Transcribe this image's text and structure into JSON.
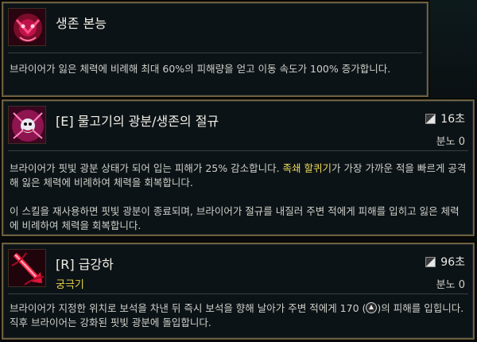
{
  "passive": {
    "title": "생존 본능",
    "description": "브라이어가 잃은 체력에 비례해 최대 60%의 피해량을 얻고 이동 속도가 100% 증가합니다."
  },
  "e_ability": {
    "title": "[E] 물고기의 광분/생존의 절규",
    "cooldown": "16초",
    "cost": "분노 0",
    "desc1_before": "브라이어가 핏빛 광분 상태가 되어 입는 피해가 25% 감소합니다. ",
    "desc1_highlight": "족쇄 할퀴기",
    "desc1_after": "가 가장 가까운 적을 빠르게 공격해 잃은 체력에 비례하여 체력을 회복합니다.",
    "desc2": "이 스킬을 재사용하면 핏빛 광분이 종료되며, 브라이어가 절규를 내질러 주변 적에게 피해를 입히고 잃은 체력에 비례하여 체력을 회복합니다."
  },
  "r_ability": {
    "title": "[R] 급강하",
    "subtitle": "궁극기",
    "cooldown": "96초",
    "cost": "분노 0",
    "desc_before": "브라이어가 지정한 위치로 보석을 차낸 뒤 즉시 보석을 향해 날아가 주변 적에게 170 (",
    "desc_after": ")의 피해를 입힙니다. 직후 브라이어는 강화된 핏빛 광분에 돌입합니다."
  },
  "icons": {
    "passive": "crimson-mask-icon",
    "e": "frenzy-icon",
    "r": "dive-spear-icon",
    "cooldown": "hourglass-icon",
    "ap": "ability-power-icon"
  },
  "colors": {
    "border": "#6e5f3e",
    "highlight": "#f1dc55",
    "panel": "#0c1317"
  }
}
